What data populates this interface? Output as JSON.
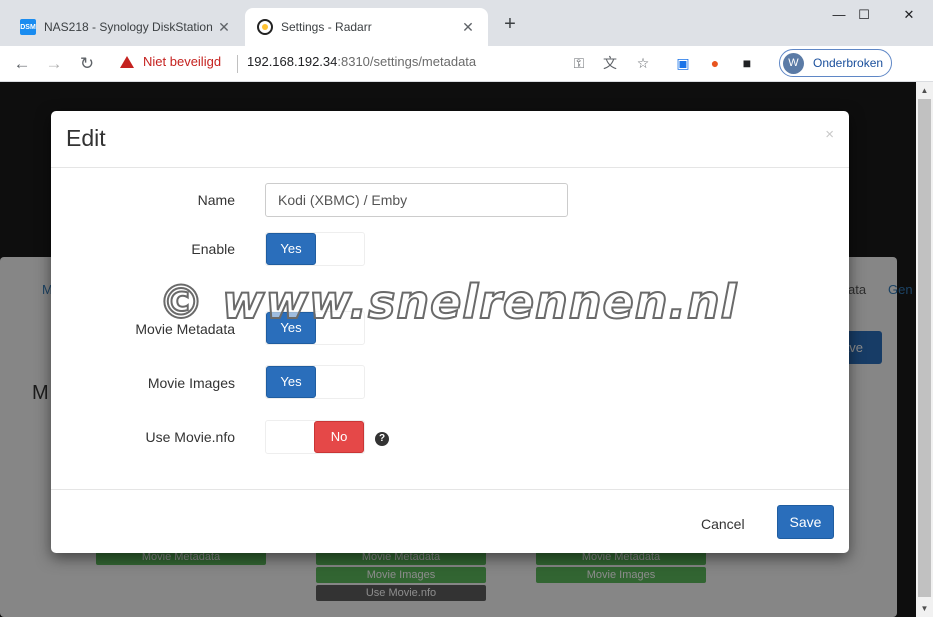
{
  "browser": {
    "tabs": [
      {
        "title": "NAS218 - Synology DiskStation",
        "favicon_text": "DSM",
        "icon": "dsm-icon"
      },
      {
        "title": "Settings - Radarr",
        "icon": "radarr-icon"
      }
    ],
    "new_tab_symbol": "+",
    "window_controls": {
      "minimize": "—",
      "maximize": "☐",
      "close": "✕"
    },
    "security_label": "Niet beveiligd",
    "url_host": "192.168.192.34",
    "url_rest": ":8310/settings/metadata",
    "profile": {
      "initial": "W",
      "name": "Onderbroken"
    }
  },
  "background_page": {
    "tab_left_fragment": "M",
    "tab_right_fragment_1": "ata",
    "tab_right_fragment_2": "Gen",
    "heading_fragment": "M",
    "save_fragment": "ave",
    "labels": [
      {
        "text": "Movie Metadata",
        "style": "green"
      },
      {
        "text": "Movie Metadata",
        "style": "green"
      },
      {
        "text": "Movie Images",
        "style": "green"
      },
      {
        "text": "Use Movie.nfo",
        "style": "dark"
      },
      {
        "text": "Movie Metadata",
        "style": "green"
      },
      {
        "text": "Movie Images",
        "style": "green"
      }
    ]
  },
  "modal": {
    "title": "Edit",
    "close_symbol": "×",
    "fields": {
      "name": {
        "label": "Name",
        "value": "Kodi (XBMC) / Emby"
      },
      "enable": {
        "label": "Enable",
        "yes_label": "Yes"
      },
      "movie_metadata": {
        "label": "Movie Metadata",
        "yes_label": "Yes"
      },
      "movie_images": {
        "label": "Movie Images",
        "yes_label": "Yes"
      },
      "use_movie_nfo": {
        "label": "Use Movie.nfo",
        "no_label": "No",
        "help_symbol": "?"
      }
    },
    "cancel_label": "Cancel",
    "save_label": "Save"
  },
  "watermark": "© www.snelrennen.nl",
  "colors": {
    "primary": "#2a6ebb",
    "danger": "#e54848",
    "success_label": "#5cb85c",
    "insecure": "#c5221f"
  }
}
